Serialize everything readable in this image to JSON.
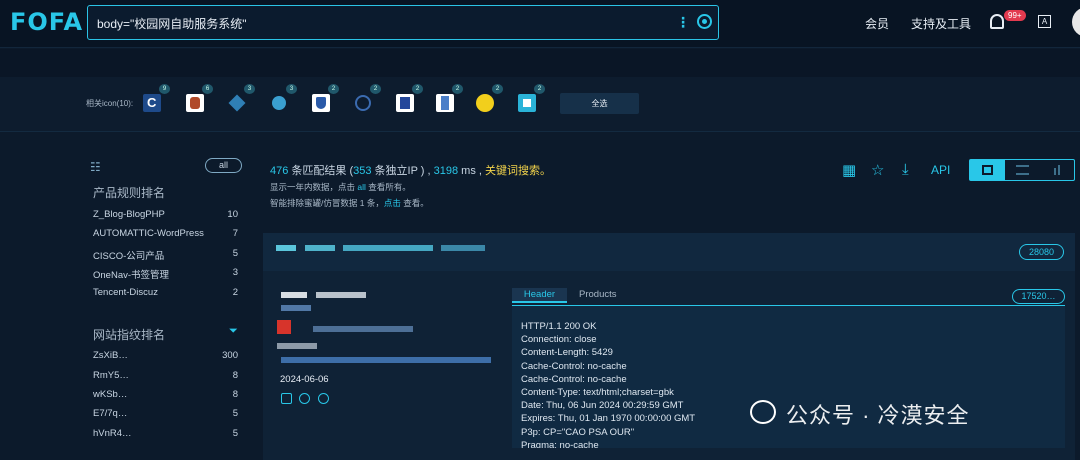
{
  "topbar": {
    "logo": "FOFA",
    "query": "body=\"校园网自助服务系统\"",
    "nav_member": "会员",
    "nav_support": "支持及工具",
    "notification_count": "99+",
    "lang_label": "A"
  },
  "icons": {
    "label": "相关icon(10):",
    "counts": [
      "9",
      "6",
      "3",
      "3",
      "2",
      "2",
      "2",
      "2",
      "2",
      "2"
    ],
    "select_all": "全选"
  },
  "sidebar": {
    "all_label": "all",
    "product_title": "产品规则排名",
    "products": [
      {
        "name": "Z_Blog-BlogPHP",
        "count": "10"
      },
      {
        "name": "AUTOMATTIC-WordPress",
        "count": "7"
      },
      {
        "name": "CISCO-公司产品",
        "count": "5"
      },
      {
        "name": "OneNav-书签管理",
        "count": "3"
      },
      {
        "name": "Tencent-Discuz",
        "count": "2"
      }
    ],
    "fingerprint_title": "网站指纹排名",
    "fingerprints": [
      {
        "name": "ZsXiB…",
        "count": "300"
      },
      {
        "name": "RmY5…",
        "count": "8"
      },
      {
        "name": "wKSb…",
        "count": "8"
      },
      {
        "name": "E7/7q…",
        "count": "5"
      },
      {
        "name": "hVnR4…",
        "count": "5"
      }
    ]
  },
  "results": {
    "total": "476",
    "text1": " 条匹配结果 (",
    "unique": "353",
    "text2": " 条独立IP ) , ",
    "ms": "3198",
    "text3": " ms , ",
    "keyword": "关键词搜索。",
    "line2a": "显示一年内数据，点击 ",
    "line2b": "all",
    "line2c": " 查看所有。",
    "line3a": "智能排除蜜罐/仿冒数据 1 条，",
    "line3b": "点击",
    "line3c": " 查看。",
    "api": "API"
  },
  "card": {
    "port": "28080",
    "date": "2024-06-06",
    "tab_header": "Header",
    "tab_products": "Products",
    "hash_pill": "17520…",
    "header_lines": [
      "HTTP/1.1 200 OK",
      "Connection: close",
      "Content-Length: 5429",
      "Cache-Control: no-cache",
      "Cache-Control: no-cache",
      "Content-Type: text/html;charset=gbk",
      "Date: Thu, 06 Jun 2024 00:29:59 GMT",
      "Expires: Thu, 01 Jan 1970 00:00:00 GMT",
      "P3p: CP=\"CAO PSA OUR\"",
      "Pragma: no-cache"
    ]
  },
  "watermark": "公众号 · 冷漠安全",
  "colors": {
    "accent": "#29c7e8",
    "bg": "#0c1a2b",
    "highlight": "#f2d34b",
    "badge": "#e33a4f"
  }
}
